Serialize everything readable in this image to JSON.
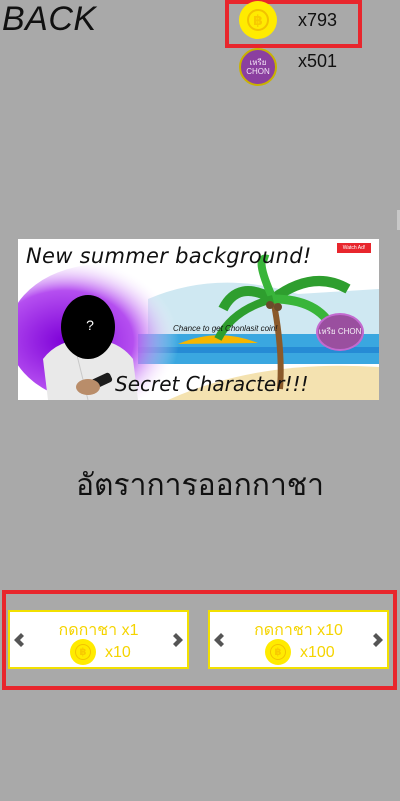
{
  "nav": {
    "back_label": "BACK"
  },
  "currency": {
    "gold_coin_count": "x793",
    "gold_coin_icon": "baht-coin-icon",
    "purple_coin_count": "x501",
    "purple_coin_label": "เหรีย CHON",
    "gold_symbol": "฿"
  },
  "banner": {
    "headline": "New summer background!",
    "tag": "Watch Ad!",
    "sub_text": "Chance to get Chonlasit coin!",
    "coin_label": "เหรีย CHON",
    "secret_text": "Secret Character!!!",
    "mystery_mark": "?"
  },
  "title": "อัตราการออกกาชา",
  "gacha": [
    {
      "label": "กดกาชา x1",
      "cost": "x10"
    },
    {
      "label": "กดกาชา x10",
      "cost": "x100"
    }
  ],
  "colors": {
    "background": "#a9a9a9",
    "highlight": "#e8262d",
    "gold": "#ffeb00",
    "button_text": "#f5d400",
    "purple_coin": "#8b3fa0"
  }
}
